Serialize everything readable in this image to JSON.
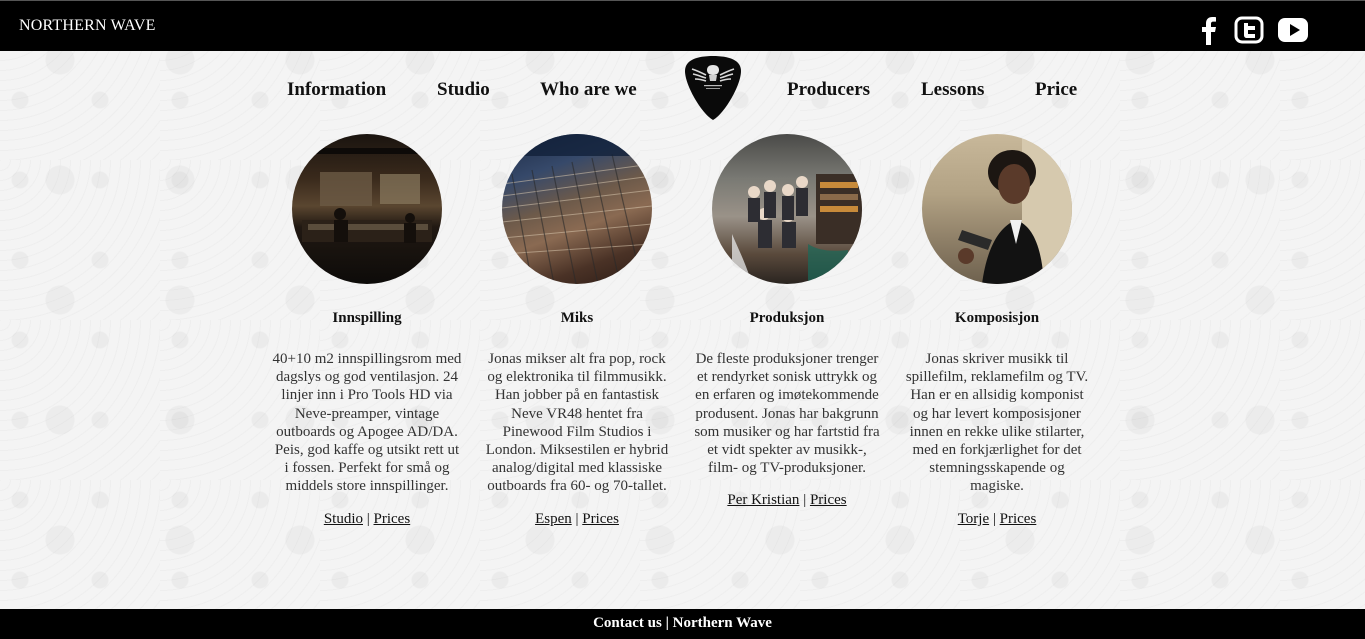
{
  "header": {
    "brand": "NORTHERN WAVE",
    "social": [
      {
        "icon": "facebook-icon"
      },
      {
        "icon": "twitter-icon"
      },
      {
        "icon": "youtube-icon"
      }
    ]
  },
  "nav": {
    "items": [
      "Information",
      "Studio",
      "Who are we",
      "Producers",
      "Lessons",
      "Price"
    ]
  },
  "services": [
    {
      "title": "Innspilling",
      "text": "40+10 m2 innspillingsrom med dagslys og god ventilasjon. 24 linjer inn i Pro Tools HD via Neve-preamper, vintage outboards og Apogee AD/DA. Peis, god kaffe og utsikt rett ut i fossen. Perfekt for små og middels store innspillinger.",
      "link1": "Studio",
      "link2": "Prices",
      "separator": "|"
    },
    {
      "title": "Miks",
      "text": "Jonas mikser alt fra pop, rock og elektronika til filmmusikk. Han jobber på en fantastisk Neve VR48 hentet fra Pinewood Film Studios i London. Miksestilen er hybrid analog/digital med klassiske outboards fra 60- og 70-tallet.",
      "link1": "Espen",
      "link2": "Prices",
      "separator": "|"
    },
    {
      "title": "Produksjon",
      "text": "De fleste produksjoner trenger et rendyrket sonisk uttrykk og en erfaren og imøtekommende produsent. Jonas har bakgrunn som musiker og har fartstid fra et vidt spekter av musikk-, film- og TV-produksjoner.",
      "link1": "Per Kristian",
      "link2": "Prices",
      "separator": "|"
    },
    {
      "title": "Komposisjon",
      "text": "Jonas skriver musikk til spillefilm, reklamefilm og TV. Han er en allsidig komponist og har levert komposisjoner innen en rekke ulike stilarter, med en forkjærlighet for det stemningsskapende og magiske.",
      "link1": "Torje",
      "link2": "Prices",
      "separator": "|"
    }
  ],
  "footer": {
    "contact": "Contact us",
    "separator": "|",
    "brand": "Northern Wave"
  },
  "colors": {
    "bar": "#000000",
    "text": "#222222",
    "background": "#f4f4f4"
  }
}
